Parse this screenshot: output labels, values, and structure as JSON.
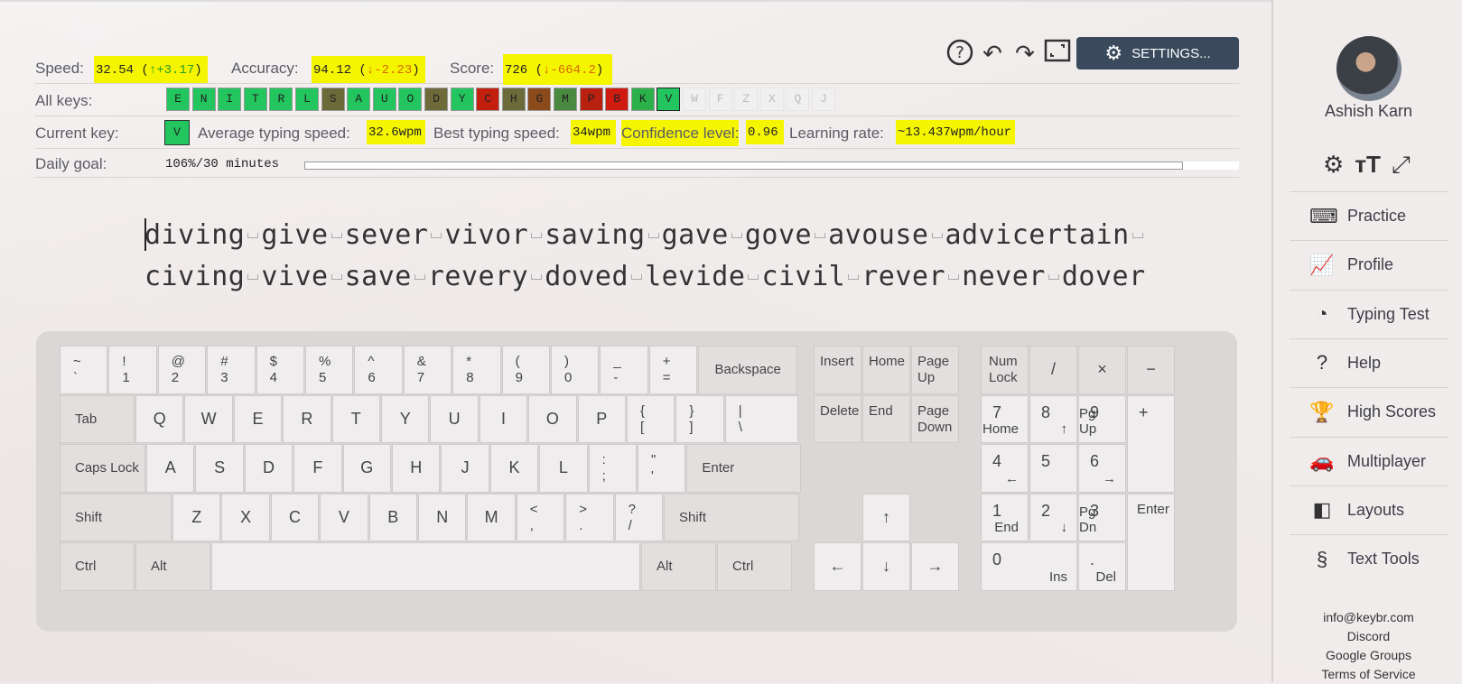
{
  "stats": {
    "speed_label": "Speed:",
    "speed_value": "32.54",
    "speed_delta": "↑+3.17",
    "accuracy_label": "Accuracy:",
    "accuracy_value": "94.12",
    "accuracy_delta": "↓-2.23",
    "score_label": "Score:",
    "score_value": "726",
    "score_delta": "↓-664.2"
  },
  "toolbar": {
    "settings_label": "SETTINGS..."
  },
  "all_keys": {
    "label": "All keys:",
    "keys": [
      {
        "k": "E",
        "c": "#22c55e"
      },
      {
        "k": "N",
        "c": "#22c55e"
      },
      {
        "k": "I",
        "c": "#22c55e"
      },
      {
        "k": "T",
        "c": "#22c55e"
      },
      {
        "k": "R",
        "c": "#22c55e"
      },
      {
        "k": "L",
        "c": "#22c55e"
      },
      {
        "k": "S",
        "c": "#6b6b3a"
      },
      {
        "k": "A",
        "c": "#22c55e"
      },
      {
        "k": "U",
        "c": "#22c55e"
      },
      {
        "k": "O",
        "c": "#22c55e"
      },
      {
        "k": "D",
        "c": "#6e6a3a"
      },
      {
        "k": "Y",
        "c": "#22c55e"
      },
      {
        "k": "C",
        "c": "#c21f0f"
      },
      {
        "k": "H",
        "c": "#6b6b3a"
      },
      {
        "k": "G",
        "c": "#8a4a1a"
      },
      {
        "k": "M",
        "c": "#4a8a40"
      },
      {
        "k": "P",
        "c": "#b8200f"
      },
      {
        "k": "B",
        "c": "#d01c10"
      },
      {
        "k": "K",
        "c": "#2bb04a"
      },
      {
        "k": "V",
        "c": "#22c55e"
      },
      {
        "k": "W",
        "c": "#f0f0f0"
      },
      {
        "k": "F",
        "c": "#f0f0f0"
      },
      {
        "k": "Z",
        "c": "#f0f0f0"
      },
      {
        "k": "X",
        "c": "#f0f0f0"
      },
      {
        "k": "Q",
        "c": "#f0f0f0"
      },
      {
        "k": "J",
        "c": "#f0f0f0"
      }
    ]
  },
  "current": {
    "label": "Current key:",
    "key": "V",
    "avg_label": "Average typing speed:",
    "avg_value": "32.6wpm",
    "best_label": "Best typing speed:",
    "best_value": "34wpm",
    "conf_label": "Confidence level:",
    "conf_value": "0.96",
    "rate_label": "Learning rate:",
    "rate_value": "~13.437wpm/hour"
  },
  "goal": {
    "label": "Daily goal:",
    "value": "106%/30 minutes",
    "progress": 1.0
  },
  "lesson": {
    "line1": [
      "diving",
      "give",
      "sever",
      "vivor",
      "saving",
      "gave",
      "gove",
      "avouse",
      "advicertain",
      ""
    ],
    "line2": [
      "civing",
      "vive",
      "save",
      "revery",
      "doved",
      "levide",
      "civil",
      "rever",
      "never",
      "dover"
    ]
  },
  "keyboard": {
    "row1": [
      [
        "~",
        "`"
      ],
      [
        "!",
        "1"
      ],
      [
        "@",
        "2"
      ],
      [
        "#",
        "3"
      ],
      [
        "$",
        "4"
      ],
      [
        "%",
        "5"
      ],
      [
        "^",
        "6"
      ],
      [
        "&",
        "7"
      ],
      [
        "*",
        "8"
      ],
      [
        "(",
        "9"
      ],
      [
        ")",
        "0"
      ],
      [
        "_",
        "-"
      ],
      [
        "+",
        "="
      ]
    ],
    "backspace": "Backspace",
    "tab": "Tab",
    "row2": [
      "Q",
      "W",
      "E",
      "R",
      "T",
      "Y",
      "U",
      "I",
      "O",
      "P"
    ],
    "row2_sym": [
      [
        "{",
        "["
      ],
      [
        "}",
        "]"
      ],
      [
        "|",
        "\\"
      ]
    ],
    "caps": "Caps Lock",
    "row3": [
      "A",
      "S",
      "D",
      "F",
      "G",
      "H",
      "J",
      "K",
      "L"
    ],
    "row3_sym": [
      [
        ":",
        ";"
      ],
      [
        "\"",
        "'"
      ]
    ],
    "enter": "Enter",
    "shift": "Shift",
    "row4": [
      "Z",
      "X",
      "C",
      "V",
      "B",
      "N",
      "M"
    ],
    "row4_sym": [
      [
        "<",
        ","
      ],
      [
        ">",
        "."
      ],
      [
        "?",
        "/"
      ]
    ],
    "ctrl": "Ctrl",
    "alt": "Alt",
    "nav": {
      "insert": "Insert",
      "home": "Home",
      "pageup1": "Page",
      "pageup2": "Up",
      "delete": "Delete",
      "end": "End",
      "pagedown1": "Page",
      "pagedown2": "Down"
    },
    "arrows": {
      "up": "↑",
      "left": "←",
      "down": "↓",
      "right": "→"
    },
    "numpad": {
      "numlock1": "Num",
      "numlock2": "Lock",
      "div": "/",
      "mul": "×",
      "minus": "−",
      "plus": "+",
      "enter": "Enter",
      "n7": "7",
      "n7s": "Home",
      "n8": "8",
      "n8s": "↑",
      "n9": "9",
      "n9s": "Pg Up",
      "n4": "4",
      "n4s": "←",
      "n5": "5",
      "n6": "6",
      "n6s": "→",
      "n1": "1",
      "n1s": "End",
      "n2": "2",
      "n2s": "↓",
      "n3": "3",
      "n3s": "Pg Dn",
      "n0": "0",
      "n0s": "Ins",
      "dot": ".",
      "dots": "Del"
    }
  },
  "sidebar": {
    "user": "Ashish Karn",
    "nav": [
      {
        "label": "Practice",
        "icon": "⌨"
      },
      {
        "label": "Profile",
        "icon": "📈"
      },
      {
        "label": "Typing Test",
        "icon": "◔"
      },
      {
        "label": "Help",
        "icon": "?"
      },
      {
        "label": "High Scores",
        "icon": "🏆"
      },
      {
        "label": "Multiplayer",
        "icon": "🚗"
      },
      {
        "label": "Layouts",
        "icon": "◧"
      },
      {
        "label": "Text Tools",
        "icon": "§"
      }
    ],
    "footer": [
      "info@keybr.com",
      "Discord",
      "Google Groups",
      "Terms of Service"
    ]
  }
}
